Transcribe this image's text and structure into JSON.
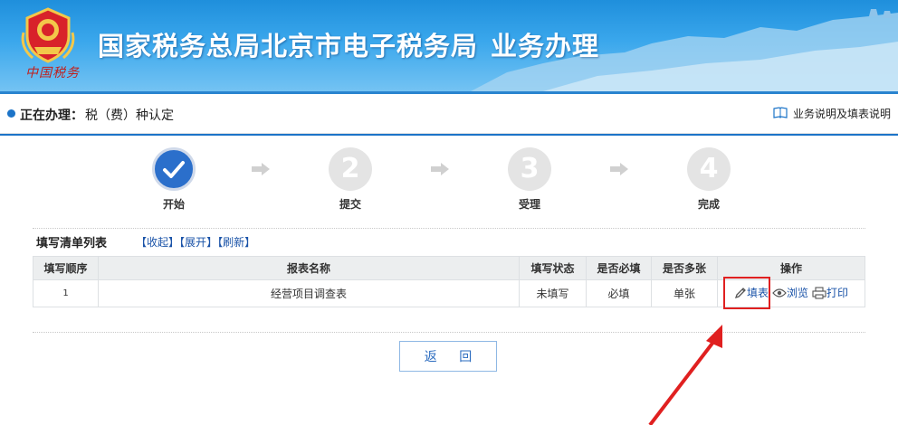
{
  "banner": {
    "title": "国家税务总局北京市电子税务局",
    "subtitle": "业务办理",
    "brand_script": "中国税务",
    "emblem_icon": "tax-emblem-icon"
  },
  "current": {
    "label": "正在办理：",
    "value": "税（费）种认定",
    "help_label": "业务说明及填表说明",
    "help_icon": "book-icon"
  },
  "steps": [
    {
      "number": "✓",
      "label": "开始",
      "active": true
    },
    {
      "number": "2",
      "label": "提交",
      "active": false
    },
    {
      "number": "3",
      "label": "受理",
      "active": false
    },
    {
      "number": "4",
      "label": "完成",
      "active": false
    }
  ],
  "list": {
    "title": "填写清单列表",
    "links": [
      "收起",
      "展开",
      "刷新"
    ],
    "columns": [
      "填写顺序",
      "报表名称",
      "填写状态",
      "是否必填",
      "是否多张",
      "操作"
    ],
    "rows": [
      {
        "seq": "1",
        "name": "经营项目调查表",
        "status": "未填写",
        "required": "必填",
        "multiple": "单张",
        "actions": [
          "填表",
          "浏览",
          "打印"
        ]
      }
    ]
  },
  "back_button": "返 回",
  "colors": {
    "accent": "#1c74c8",
    "link": "#1a53a8",
    "highlight": "#e02020",
    "banner": "#2a95de"
  }
}
